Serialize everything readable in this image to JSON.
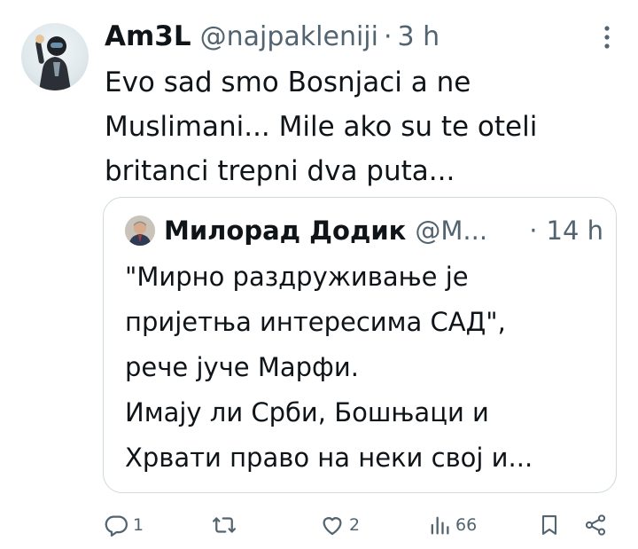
{
  "tweet": {
    "display_name": "Am3L",
    "handle": "@najpakleniji",
    "separator": "·",
    "time": "3 h",
    "text": "Evo sad smo Bosnjaci a ne Muslimani... Mile ako su te oteli britanci trepni dva puta...",
    "more_icon": "more-vertical-icon"
  },
  "quoted_tweet": {
    "display_name": "Милорад Додик",
    "handle": "@M...",
    "separator": "·",
    "time": "14 h",
    "lines": [
      "\"Мирно раздруживање је",
      "пријетња интересима САД\",",
      "рече јуче Марфи.",
      "Имају ли Срби, Бошњаци и",
      "Хрвати право на неки свој и..."
    ]
  },
  "actions": {
    "replies": "1",
    "retweets": "",
    "likes": "2",
    "views": "66",
    "icons": [
      "reply-icon",
      "retweet-icon",
      "like-icon",
      "views-icon",
      "bookmark-icon",
      "share-icon"
    ]
  },
  "colors": {
    "text": "#0f1419",
    "secondary": "#536471",
    "border": "#cfd9de"
  }
}
